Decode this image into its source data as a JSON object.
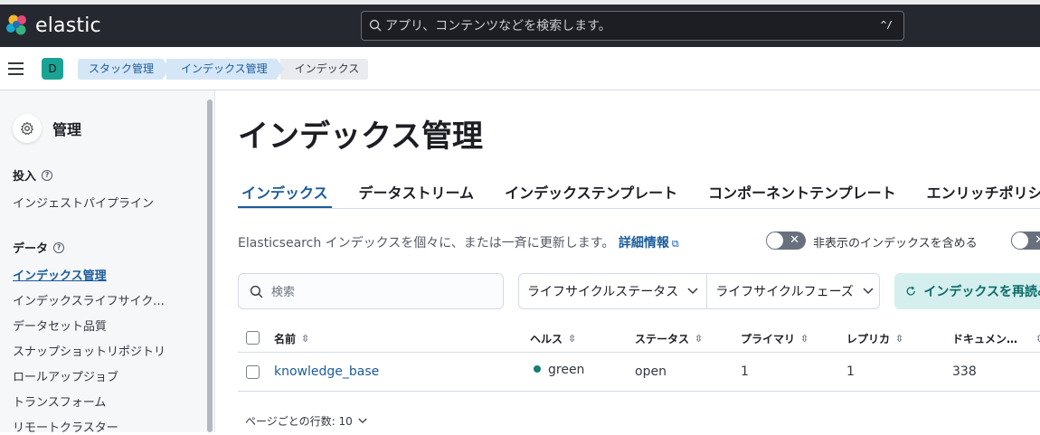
{
  "header": {
    "brand": "elastic",
    "search": {
      "placeholder": "アプリ、コンテンツなどを検索します。",
      "shortcut": "^/"
    }
  },
  "breadcrumbs": {
    "space_initial": "D",
    "items": [
      "スタック管理",
      "インデックス管理",
      "インデックス"
    ]
  },
  "sidebar": {
    "title": "管理",
    "sections": [
      {
        "label": "投入",
        "items": [
          "インジェストパイプライン"
        ]
      },
      {
        "label": "データ",
        "items": [
          "インデックス管理",
          "インデックスライフサイクルポリシー",
          "データセット品質",
          "スナップショットリポジトリ",
          "ロールアップジョブ",
          "トランスフォーム",
          "リモートクラスター"
        ]
      }
    ],
    "active_item": "インデックス管理"
  },
  "main": {
    "title": "インデックス管理",
    "tabs": [
      "インデックス",
      "データストリーム",
      "インデックステンプレート",
      "コンポーネントテンプレート",
      "エンリッチポリシー"
    ],
    "active_tab": "インデックス",
    "description": "Elasticsearch インデックスを個々に、または一斉に更新します。",
    "more_link": "詳細情報",
    "toggle_label": "非表示のインデックスを含める",
    "search_placeholder": "検索",
    "filters": [
      "ライフサイクルステータス",
      "ライフサイクルフェーズ"
    ],
    "reload_label": "インデックスを再読み込み",
    "table": {
      "columns": [
        "名前",
        "ヘルス",
        "ステータス",
        "プライマリ",
        "レプリカ",
        "ドキュメン…"
      ],
      "rows": [
        {
          "name": "knowledge_base",
          "health": "green",
          "status": "open",
          "primary": "1",
          "replica": "1",
          "docs": "338"
        }
      ]
    },
    "rows_per_page": "ページごとの行数: 10"
  },
  "colors": {
    "header_bg": "#25282f",
    "link": "#1a5b9c",
    "health_green": "#167d74",
    "accent_button": "#d4efee"
  }
}
